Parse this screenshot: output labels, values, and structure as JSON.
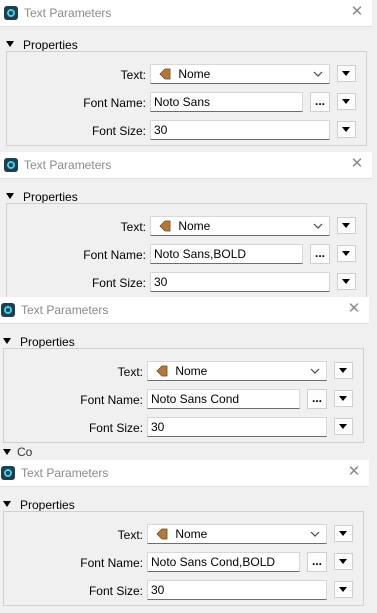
{
  "panels": [
    {
      "title": "Text Parameters",
      "section": "Properties",
      "labels": {
        "text": "Text:",
        "font_name": "Font Name:",
        "font_size": "Font Size:"
      },
      "text_value": "Nome",
      "font_name": "Noto Sans",
      "font_size": "30"
    },
    {
      "title": "Text Parameters",
      "section": "Properties",
      "labels": {
        "text": "Text:",
        "font_name": "Font Name:",
        "font_size": "Font Size:"
      },
      "text_value": "Nome",
      "font_name": "Noto Sans,BOLD",
      "font_size": "30"
    },
    {
      "title": "Text Parameters",
      "section": "Properties",
      "labels": {
        "text": "Text:",
        "font_name": "Font Name:",
        "font_size": "Font Size:"
      },
      "text_value": "Nome",
      "font_name": "Noto Sans Cond",
      "font_size": "30",
      "next_section_peek": "Co"
    },
    {
      "title": "Text Parameters",
      "section": "Properties",
      "labels": {
        "text": "Text:",
        "font_name": "Font Name:",
        "font_size": "Font Size:"
      },
      "text_value": "Nome",
      "font_name": "Noto Sans Cond,BOLD",
      "font_size": "30"
    }
  ],
  "icons": {
    "app": "fme-app-icon",
    "close": "close-icon",
    "expand": "triangle-down-icon",
    "attribute": "attribute-tag-icon",
    "chevron": "chevron-down-icon",
    "menu": "menu-arrow-icon"
  },
  "ellipsis_label": "...",
  "colors": {
    "background": "#f0f0f0",
    "titlebar": "#ffffff",
    "app_icon_dark": "#1f3f4f",
    "app_icon_ring": "#3fd0e8",
    "attribute_tag": "#b07a3c",
    "title_text": "#8a8a8a"
  }
}
